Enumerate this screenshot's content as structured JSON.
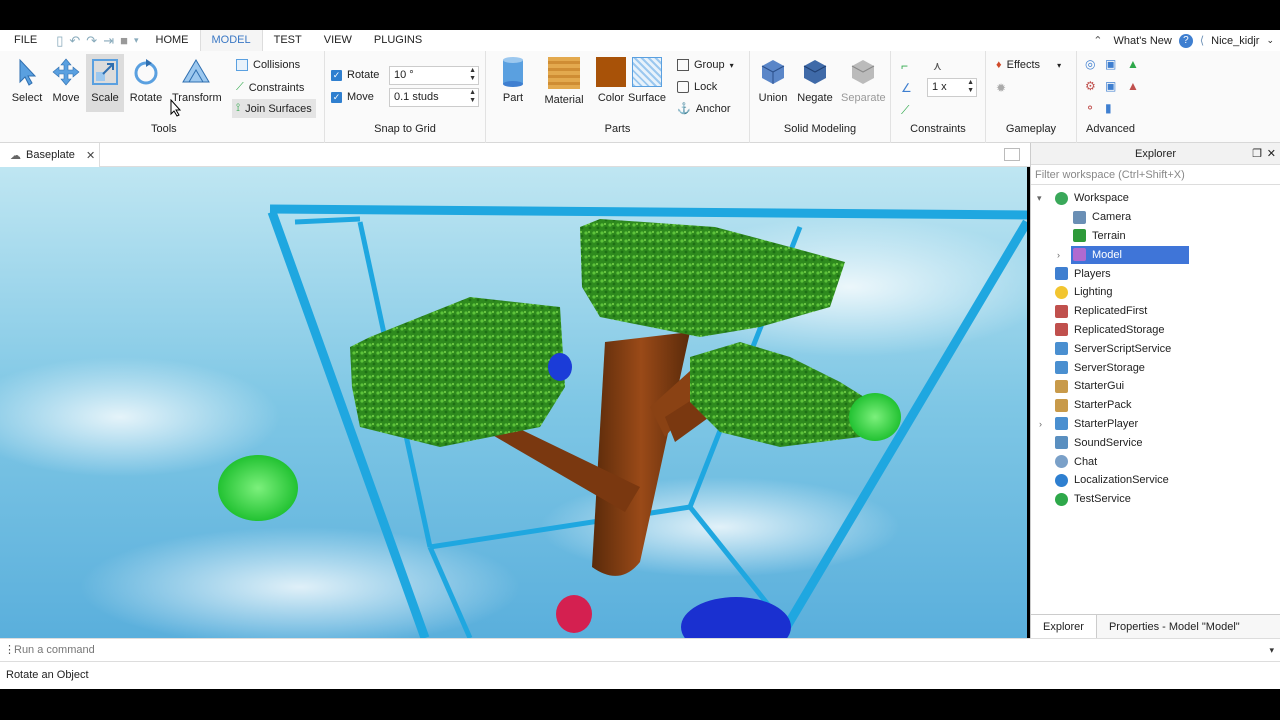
{
  "menu": {
    "file": "FILE",
    "tabs": [
      "HOME",
      "MODEL",
      "TEST",
      "VIEW",
      "PLUGINS"
    ],
    "whats_new": "What's New",
    "user": "Nice_kidjr"
  },
  "tools": {
    "select": "Select",
    "move": "Move",
    "scale": "Scale",
    "rotate": "Rotate",
    "transform": "Transform",
    "collisions": "Collisions",
    "constraints": "Constraints",
    "join_surfaces": "Join Surfaces",
    "group_label": "Tools"
  },
  "snap": {
    "rotate_label": "Rotate",
    "rotate_value": "10 °",
    "move_label": "Move",
    "move_value": "0.1 studs",
    "group_label": "Snap to Grid"
  },
  "parts": {
    "part": "Part",
    "material": "Material",
    "color": "Color",
    "surface": "Surface",
    "group": "Group",
    "lock": "Lock",
    "anchor": "Anchor",
    "group_label": "Parts"
  },
  "solid": {
    "union": "Union",
    "negate": "Negate",
    "separate": "Separate",
    "group_label": "Solid Modeling"
  },
  "constraints": {
    "scale_value": "1 x",
    "group_label": "Constraints"
  },
  "gameplay": {
    "effects": "Effects",
    "group_label": "Gameplay"
  },
  "advanced": {
    "group_label": "Advanced"
  },
  "doc_tab": {
    "label": "Baseplate"
  },
  "explorer": {
    "title": "Explorer",
    "filter_placeholder": "Filter workspace (Ctrl+Shift+X)",
    "items": [
      {
        "label": "Workspace",
        "icon": "workspace-icon",
        "color": "#3aa85a"
      },
      {
        "label": "Camera",
        "icon": "camera-icon",
        "color": "#6a8fb5"
      },
      {
        "label": "Terrain",
        "icon": "terrain-icon",
        "color": "#2e9a3a"
      },
      {
        "label": "Model",
        "icon": "model-icon",
        "color": "#b06ad0"
      },
      {
        "label": "Players",
        "icon": "players-icon",
        "color": "#3f7fd0"
      },
      {
        "label": "Lighting",
        "icon": "lighting-icon",
        "color": "#f2c530"
      },
      {
        "label": "ReplicatedFirst",
        "icon": "replicated-first-icon",
        "color": "#c0504d"
      },
      {
        "label": "ReplicatedStorage",
        "icon": "replicated-storage-icon",
        "color": "#c0504d"
      },
      {
        "label": "ServerScriptService",
        "icon": "server-script-service-icon",
        "color": "#4a8fd0"
      },
      {
        "label": "ServerStorage",
        "icon": "server-storage-icon",
        "color": "#4a8fd0"
      },
      {
        "label": "StarterGui",
        "icon": "starter-gui-icon",
        "color": "#c89a4a"
      },
      {
        "label": "StarterPack",
        "icon": "starter-pack-icon",
        "color": "#c89a4a"
      },
      {
        "label": "StarterPlayer",
        "icon": "starter-player-icon",
        "color": "#4a8fd0"
      },
      {
        "label": "SoundService",
        "icon": "sound-service-icon",
        "color": "#5a8fc0"
      },
      {
        "label": "Chat",
        "icon": "chat-icon",
        "color": "#7aa0c8"
      },
      {
        "label": "LocalizationService",
        "icon": "localization-service-icon",
        "color": "#2e7fd0"
      },
      {
        "label": "TestService",
        "icon": "test-service-icon",
        "color": "#2ea84a"
      }
    ],
    "tab_explorer": "Explorer",
    "tab_properties": "Properties - Model \"Model\""
  },
  "command_bar": {
    "placeholder": "Run a command"
  },
  "status": {
    "text": "Rotate an Object"
  }
}
